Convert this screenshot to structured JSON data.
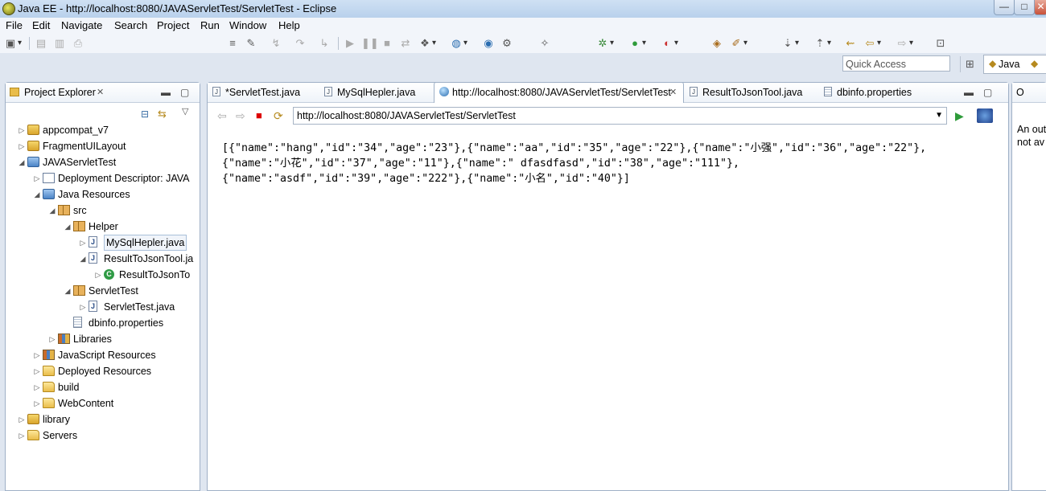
{
  "window": {
    "title": "Java EE - http://localhost:8080/JAVAServletTest/ServletTest - Eclipse",
    "minimize": "—",
    "restore": "□",
    "close": "✕"
  },
  "menu": [
    "File",
    "Edit",
    "Navigate",
    "Search",
    "Project",
    "Run",
    "Window",
    "Help"
  ],
  "toolbar": {
    "quick_access_placeholder": "Quick Access",
    "perspective_label": "Java"
  },
  "project_explorer": {
    "title": "Project Explorer",
    "close": "✕",
    "tree": [
      {
        "label": "appcompat_v7",
        "depth": 0,
        "twisty": "▷",
        "icon": "project"
      },
      {
        "label": "FragmentUILayout",
        "depth": 0,
        "twisty": "▷",
        "icon": "project"
      },
      {
        "label": "JAVAServletTest",
        "depth": 0,
        "twisty": "◢",
        "icon": "jee-project"
      },
      {
        "label": "Deployment Descriptor: JAVA",
        "depth": 1,
        "twisty": "▷",
        "icon": "descriptor"
      },
      {
        "label": "Java Resources",
        "depth": 1,
        "twisty": "◢",
        "icon": "jee-project"
      },
      {
        "label": "src",
        "depth": 2,
        "twisty": "◢",
        "icon": "source-folder"
      },
      {
        "label": "Helper",
        "depth": 3,
        "twisty": "◢",
        "icon": "package"
      },
      {
        "label": "MySqlHepler.java",
        "depth": 4,
        "twisty": "▷",
        "icon": "java-file",
        "selected": true
      },
      {
        "label": "ResultToJsonTool.ja",
        "depth": 4,
        "twisty": "◢",
        "icon": "java-file"
      },
      {
        "label": "ResultToJsonTo",
        "depth": 5,
        "twisty": "▷",
        "icon": "class"
      },
      {
        "label": "ServletTest",
        "depth": 3,
        "twisty": "◢",
        "icon": "package"
      },
      {
        "label": "ServletTest.java",
        "depth": 4,
        "twisty": "▷",
        "icon": "java-file"
      },
      {
        "label": "dbinfo.properties",
        "depth": 3,
        "twisty": "",
        "icon": "properties-file"
      },
      {
        "label": "Libraries",
        "depth": 2,
        "twisty": "▷",
        "icon": "library"
      },
      {
        "label": "JavaScript Resources",
        "depth": 1,
        "twisty": "▷",
        "icon": "library"
      },
      {
        "label": "Deployed Resources",
        "depth": 1,
        "twisty": "▷",
        "icon": "folder"
      },
      {
        "label": "build",
        "depth": 1,
        "twisty": "▷",
        "icon": "folder"
      },
      {
        "label": "WebContent",
        "depth": 1,
        "twisty": "▷",
        "icon": "folder"
      },
      {
        "label": "library",
        "depth": 0,
        "twisty": "▷",
        "icon": "project"
      },
      {
        "label": "Servers",
        "depth": 0,
        "twisty": "▷",
        "icon": "folder"
      }
    ]
  },
  "editor": {
    "tabs": [
      {
        "label": "*ServletTest.java",
        "icon": "java-file",
        "active": false
      },
      {
        "label": "MySqlHepler.java",
        "icon": "java-file",
        "active": false
      },
      {
        "label": "http://localhost:8080/JAVAServletTest/ServletTest",
        "icon": "globe",
        "active": true,
        "close": "✕"
      },
      {
        "label": "ResultToJsonTool.java",
        "icon": "java-file",
        "active": false
      },
      {
        "label": "dbinfo.properties",
        "icon": "properties-file",
        "active": false
      }
    ],
    "url": "http://localhost:8080/JAVAServletTest/ServletTest",
    "content_lines": [
      "[{\"name\":\"hang\",\"id\":\"34\",\"age\":\"23\"},{\"name\":\"aa\",\"id\":\"35\",\"age\":\"22\"},{\"name\":\"小强\",\"id\":\"36\",\"age\":\"22\"},",
      "{\"name\":\"小花\",\"id\":\"37\",\"age\":\"11\"},{\"name\":\" dfasdfasd\",\"id\":\"38\",\"age\":\"111\"},",
      "{\"name\":\"asdf\",\"id\":\"39\",\"age\":\"222\"},{\"name\":\"小名\",\"id\":\"40\"}]"
    ]
  },
  "outline": {
    "title": "O",
    "lines": [
      "An out",
      "not av"
    ]
  }
}
